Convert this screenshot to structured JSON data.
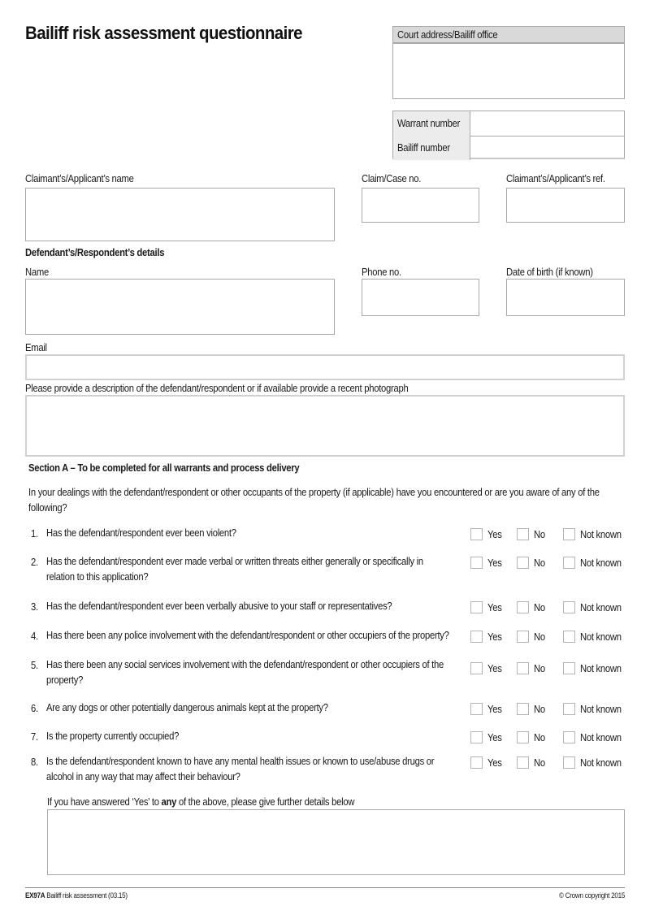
{
  "page_title": "Bailiff risk assessment questionnaire",
  "court": {
    "header_label": "Court address/Bailiff office",
    "value": ""
  },
  "warrant_table": {
    "rows": [
      {
        "label": "Warrant number",
        "value": ""
      },
      {
        "label": "Bailiff number",
        "value": ""
      }
    ]
  },
  "claimant": {
    "name_label": "Claimant’s/Applicant’s name",
    "name_value": "",
    "case_label": "Claim/Case no.",
    "case_value": "",
    "ref_label": "Claimant’s/Applicant’s ref.",
    "ref_value": ""
  },
  "defendant": {
    "section_heading": "Defendant’s/Respondent’s details",
    "name_label": "Name",
    "name_value": "",
    "phone_label": "Phone no.",
    "phone_value": "",
    "dob_label": "Date of birth (if known)",
    "dob_value": "",
    "email_label": "Email",
    "email_value": "",
    "description_label": "Please provide a description of the defendant/respondent or if available provide a recent photograph",
    "description_value": ""
  },
  "section_a": {
    "heading": "Section A – To be completed for all warrants and process delivery",
    "intro": "In your dealings with the defendant/respondent or other occupants of the property (if applicable) have you encountered or are you aware of any of the following?",
    "options": [
      "Yes",
      "No",
      "Not known"
    ],
    "questions": [
      {
        "num": "1.",
        "text": "Has the defendant/respondent ever been violent?",
        "answer": null
      },
      {
        "num": "2.",
        "text": "Has the defendant/respondent ever made verbal or written threats either generally or specifically in relation to this application?",
        "answer": null
      },
      {
        "num": "3.",
        "text": "Has the defendant/respondent ever been verbally abusive to your staff or representatives?",
        "answer": null
      },
      {
        "num": "4.",
        "text": "Has there been any police involvement with the defendant/respondent or other occupiers of the property?",
        "answer": null
      },
      {
        "num": "5.",
        "text": "Has there been any social services involvement with the defendant/respondent or other occupiers of the property?",
        "answer": null
      },
      {
        "num": "6.",
        "text": "Are any dogs or other potentially dangerous animals kept at the property?",
        "answer": null
      },
      {
        "num": "7.",
        "text": "Is the property currently occupied?",
        "answer": null
      },
      {
        "num": "8.",
        "text": "Is the defendant/respondent known to have any mental health issues or known to use/abuse drugs or alcohol in any way that may affect their behaviour?",
        "answer": null
      }
    ],
    "details_prefix": "If you have answered ‘Yes’ to ",
    "details_bold": "any",
    "details_suffix": " of the above, please give further details below",
    "details_value": ""
  },
  "footer": {
    "form_code": "EX97A",
    "form_name": " Bailiff risk assessment (03.15)",
    "copyright": "© Crown copyright 2015"
  },
  "colors": {
    "field_border": "#a8a8a8",
    "header_fill": "#d9d9d9",
    "label_cell_fill": "#ececec"
  }
}
